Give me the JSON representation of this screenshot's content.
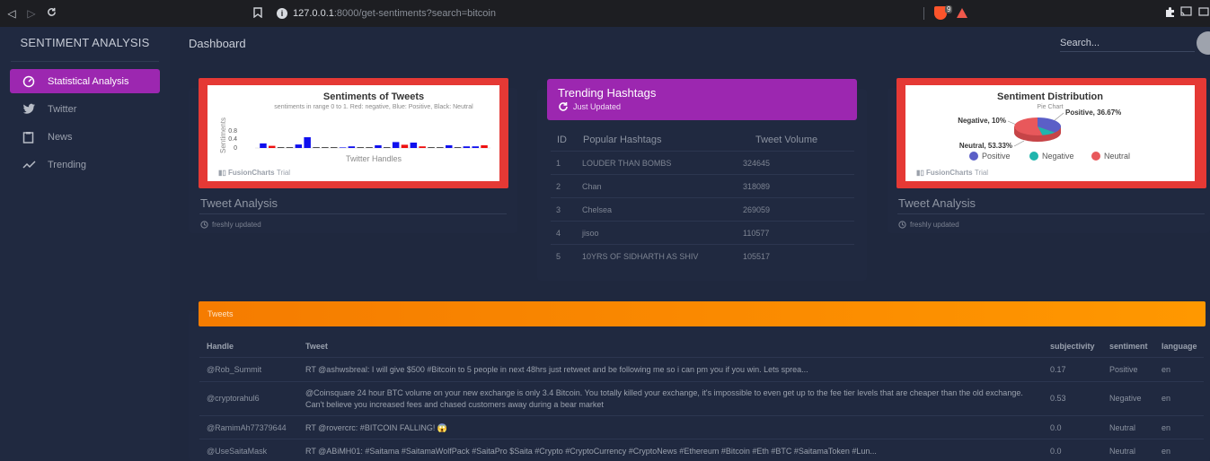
{
  "browser": {
    "url_host": "127.0.0.1",
    "url_path": ":8000/get-sentiments?search=bitcoin"
  },
  "sidebar": {
    "brand": "SENTIMENT ANALYSIS",
    "items": [
      {
        "label": "Statistical Analysis",
        "icon": "dashboard-gauge-icon",
        "active": true
      },
      {
        "label": "Twitter",
        "icon": "twitter-bird-icon",
        "active": false
      },
      {
        "label": "News",
        "icon": "clipboard-icon",
        "active": false
      },
      {
        "label": "Trending",
        "icon": "trending-up-icon",
        "active": false
      }
    ]
  },
  "header": {
    "title": "Dashboard",
    "search_placeholder": "Search..."
  },
  "colors": {
    "accent_purple": "#9c27b0",
    "card_red": "#e53935",
    "tweets_orange": "#fb8c00",
    "bar_blue": "#1010ee",
    "bar_red": "#ee1010",
    "pie_positive": "#5b5fc7",
    "pie_negative": "#1fb5ad",
    "pie_neutral": "#e8585b"
  },
  "tweet_card": {
    "chart_title": "Sentiments of Tweets",
    "chart_subtitle": "sentiments in range 0 to 1. Red: negative, Blue: Positive, Black: Neutral",
    "ylabel": "Sentiments",
    "xlabel": "Twitter Handles",
    "y_ticks": [
      "0.8",
      "0.4",
      "0"
    ],
    "trial_brand": "FusionCharts",
    "trial_word": "Trial",
    "title": "Tweet Analysis",
    "footer": "freshly updated"
  },
  "dist_card": {
    "chart_title": "Sentiment Distribution",
    "chart_subtitle": "Pie Chart",
    "label_negative": "Negative, 10%",
    "label_positive": "Positive, 36.67%",
    "label_neutral": "Neutral, 53.33%",
    "legend": [
      "Positive",
      "Negative",
      "Neutral"
    ],
    "trial_brand": "FusionCharts",
    "trial_word": "Trial",
    "title": "Tweet Analysis",
    "footer": "freshly updated"
  },
  "hashtags": {
    "title": "Trending Hashtags",
    "subtitle": "Just Updated",
    "columns": [
      "ID",
      "Popular Hashtags",
      "Tweet Volume"
    ],
    "rows": [
      {
        "id": "1",
        "tag": "LOUDER THAN BOMBS",
        "volume": "324645"
      },
      {
        "id": "2",
        "tag": "Chan",
        "volume": "318089"
      },
      {
        "id": "3",
        "tag": "Chelsea",
        "volume": "269059"
      },
      {
        "id": "4",
        "tag": "jisoo",
        "volume": "110577"
      },
      {
        "id": "5",
        "tag": "10YRS OF SIDHARTH AS SHIV",
        "volume": "105517"
      }
    ]
  },
  "tweets": {
    "label": "Tweets",
    "columns": [
      "Handle",
      "Tweet",
      "subjectivity",
      "sentiment",
      "language"
    ],
    "rows": [
      {
        "handle": "@Rob_Summit",
        "tweet": "RT @ashwsbreal: I will give $500 #Bitcoin to 5 people in next 48hrs just retweet and be following me so i can pm you if you win. Lets sprea...",
        "subjectivity": "0.17",
        "sentiment": "Positive",
        "language": "en"
      },
      {
        "handle": "@cryptorahul6",
        "tweet": "@Coinsquare 24 hour BTC volume on your new exchange is only 3.4 Bitcoin. You totally killed your exchange, it's impossible to even get up to the fee tier levels that are cheaper than the old exchange. Can't believe you increased fees and chased customers away during a bear market",
        "subjectivity": "0.53",
        "sentiment": "Negative",
        "language": "en"
      },
      {
        "handle": "@RamimAh77379644",
        "tweet": "RT @rovercrc: #BITCOIN FALLING! 😱",
        "subjectivity": "0.0",
        "sentiment": "Neutral",
        "language": "en"
      },
      {
        "handle": "@UseSaitaMask",
        "tweet": "RT @ABiMH01: #Saitama #SaitamaWolfPack #SaitaPro $Saita #Crypto #CryptoCurrency #CryptoNews #Ethereum #Bitcoin #Eth #BTC #SaitamaToken #Lun...",
        "subjectivity": "0.0",
        "sentiment": "Neutral",
        "language": "en"
      }
    ]
  },
  "chart_data": [
    {
      "type": "bar",
      "title": "Sentiments of Tweets",
      "subtitle": "sentiments in range 0 to 1. Red: negative, Blue: Positive, Black: Neutral",
      "xlabel": "Twitter Handles",
      "ylabel": "Sentiments",
      "ylim": [
        0,
        1
      ],
      "values": [
        0.17,
        0.08,
        0.0,
        0.0,
        0.13,
        0.4,
        0.0,
        0.0,
        0.0,
        0.02,
        0.06,
        0.0,
        0.0,
        0.1,
        0.0,
        0.22,
        0.12,
        0.2,
        0.06,
        0.0,
        0.0,
        0.1,
        0.0,
        0.06,
        0.06,
        0.1
      ],
      "colors": [
        "blue",
        "red",
        "black",
        "black",
        "blue",
        "blue",
        "black",
        "black",
        "black",
        "blue",
        "blue",
        "black",
        "black",
        "blue",
        "black",
        "blue",
        "red",
        "blue",
        "red",
        "black",
        "black",
        "blue",
        "black",
        "blue",
        "blue",
        "red"
      ]
    },
    {
      "type": "pie",
      "title": "Sentiment Distribution",
      "subtitle": "Pie Chart",
      "categories": [
        "Positive",
        "Negative",
        "Neutral"
      ],
      "values": [
        36.67,
        10,
        53.33
      ],
      "legend": "bottom"
    }
  ]
}
